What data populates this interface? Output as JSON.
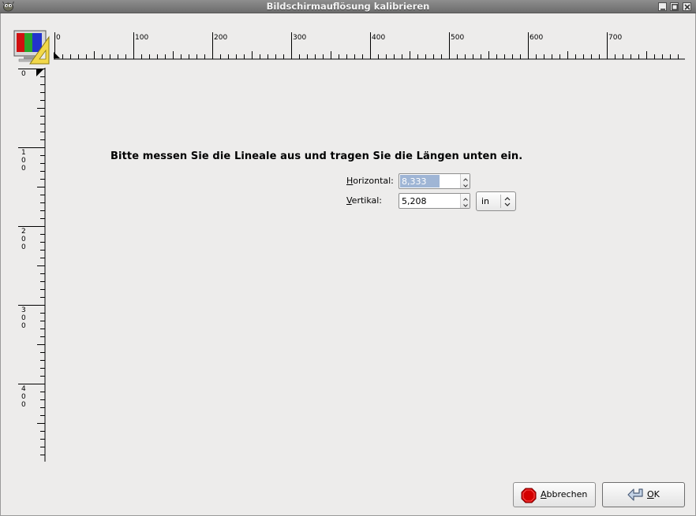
{
  "window": {
    "title": "Bildschirmauflösung kalibrieren"
  },
  "instruction": "Bitte messen Sie die Lineale aus und tragen Sie die Längen unten ein.",
  "horizontal": {
    "label_mnemonic": "H",
    "label_rest": "orizontal:",
    "value": "8,333"
  },
  "vertical": {
    "label_mnemonic": "V",
    "label_rest": "ertikal:",
    "value": "5,208"
  },
  "unit": {
    "selected": "in"
  },
  "rulers": {
    "horizontal_labels": [
      "0",
      "100",
      "200",
      "300",
      "400",
      "500",
      "600",
      "700"
    ],
    "vertical_labels": [
      "0",
      "100",
      "200",
      "300",
      "400"
    ]
  },
  "buttons": {
    "cancel_mnemonic": "A",
    "cancel_rest": "bbrechen",
    "ok_mnemonic": "O",
    "ok_rest": "K"
  },
  "icons": {
    "app": "gimp-icon",
    "monitor": "monitor-ruler-icon",
    "cancel": "stop-icon",
    "ok": "return-arrow-icon"
  }
}
